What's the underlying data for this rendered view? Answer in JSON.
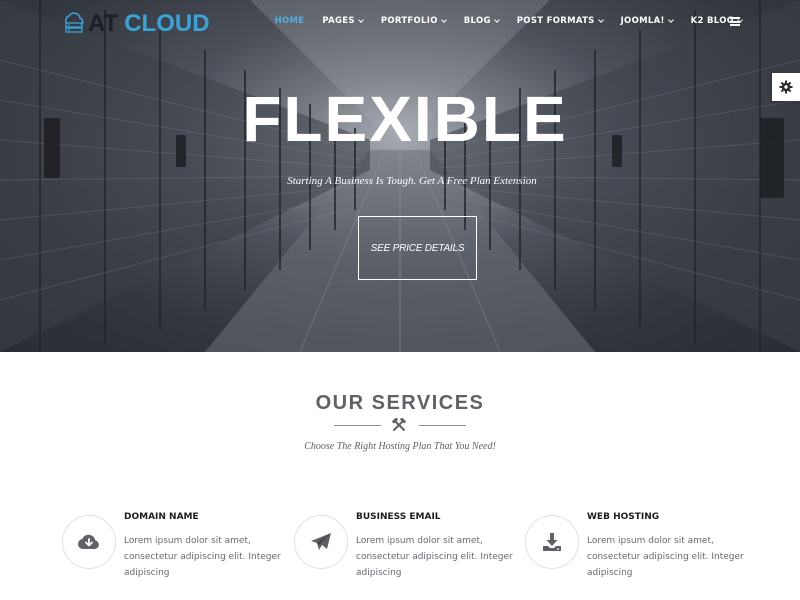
{
  "header": {
    "logo_prefix": "AT",
    "logo_suffix": "CLOUD",
    "nav": [
      {
        "label": "HOME",
        "active": true,
        "dropdown": false
      },
      {
        "label": "PAGES",
        "active": false,
        "dropdown": true
      },
      {
        "label": "PORTFOLIO",
        "active": false,
        "dropdown": true
      },
      {
        "label": "BLOG",
        "active": false,
        "dropdown": true
      },
      {
        "label": "POST FORMATS",
        "active": false,
        "dropdown": true
      },
      {
        "label": "JOOMLA!",
        "active": false,
        "dropdown": true
      },
      {
        "label": "K2 BLOG",
        "active": false,
        "dropdown": true
      }
    ],
    "menu_icon": "hamburger-icon"
  },
  "settings": {
    "icon": "gear-icon"
  },
  "hero": {
    "title": "FLEXIBLE",
    "subtitle": "Starting A Business Is Tough. Get A Free Plan Extension",
    "button_label": "SEE PRICE DETAILS"
  },
  "services": {
    "title": "OUR SERVICES",
    "divider_icon": "crossed-tools-icon",
    "subtitle": "Choose The Right Hosting Plan That You Need!",
    "items": [
      {
        "title": "DOMAIN NAME",
        "text": "Lorem ipsum dolor sit amet, consectetur adipiscing elit. Integer adipiscing",
        "icon": "cloud-download-icon"
      },
      {
        "title": "BUSINESS EMAIL",
        "text": "Lorem ipsum dolor sit amet, consectetur adipiscing elit. Integer adipiscing",
        "icon": "paper-plane-icon"
      },
      {
        "title": "WEB HOSTING",
        "text": "Lorem ipsum dolor sit amet, consectetur adipiscing elit. Integer adipiscing",
        "icon": "download-tray-icon"
      }
    ]
  },
  "colors": {
    "accent": "#3aa3d9",
    "nav_active": "#55aee0",
    "heading": "#5f6166",
    "body_text": "#666a70"
  }
}
